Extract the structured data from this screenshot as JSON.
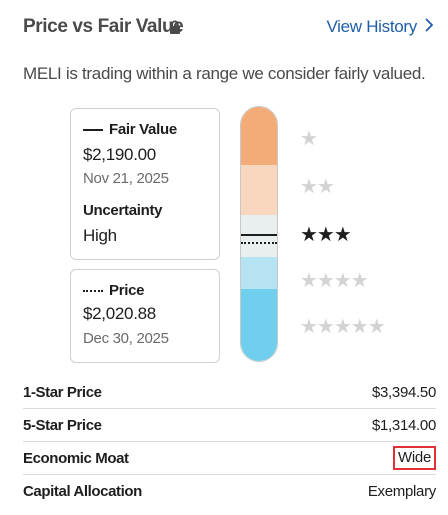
{
  "header": {
    "title": "Price vs Fair Value",
    "view_history_label": "View History",
    "view_history_arrow": "›"
  },
  "subtitle": "MELI is trading within a range we consider fairly valued.",
  "fair_value_card": {
    "label": "Fair Value",
    "value": "$2,190.00",
    "date": "Nov 21, 2025",
    "uncertainty_label": "Uncertainty",
    "uncertainty_value": "High"
  },
  "price_card": {
    "label": "Price",
    "value": "$2,020.88",
    "date": "Dec 30, 2025"
  },
  "star_rating": {
    "current_stars": 3,
    "rows": [
      {
        "stars": "★"
      },
      {
        "stars": "★★"
      },
      {
        "stars": "★★★"
      },
      {
        "stars": "★★★★"
      },
      {
        "stars": "★★★★★"
      }
    ],
    "colors": {
      "band_1": "#f3ab78",
      "band_2": "#f9d6be",
      "band_3": "#e9eeee",
      "band_4": "#b6e3f2",
      "band_5": "#6fcfec",
      "active_star": "#1e1e1e",
      "inactive_star": "#d3d3d3"
    }
  },
  "table": {
    "rows": [
      {
        "key": "1-Star Price",
        "value": "$3,394.50"
      },
      {
        "key": "5-Star Price",
        "value": "$1,314.00"
      },
      {
        "key": "Economic Moat",
        "value": "Wide"
      },
      {
        "key": "Capital Allocation",
        "value": "Exemplary"
      }
    ]
  },
  "colors": {
    "link": "#1f5fa8",
    "highlight_border": "#e0313a"
  }
}
